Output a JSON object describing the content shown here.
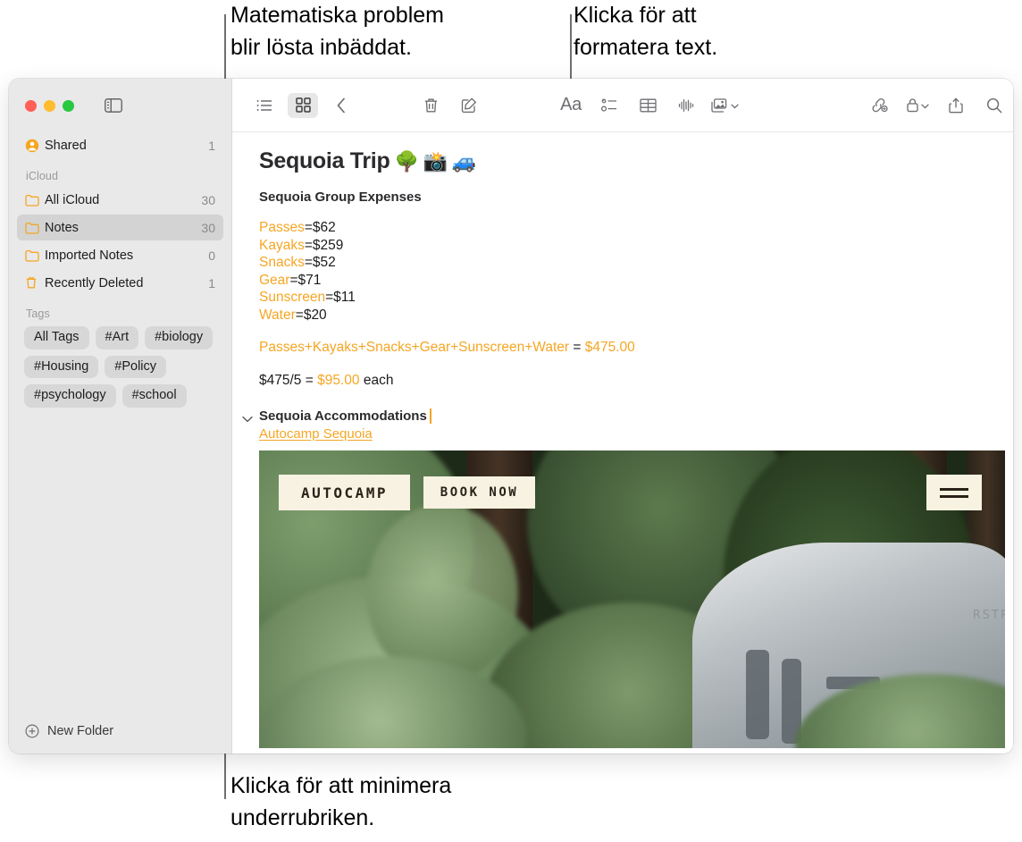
{
  "callouts": {
    "math": "Matematiska problem\nblir lösta inbäddat.",
    "format": "Klicka för att\nformatera text.",
    "minimize": "Klicka för att minimera\nunderrubriken."
  },
  "window": {
    "traffic": {
      "close": "close-button",
      "minimize": "minimize-button",
      "zoom": "zoom-button"
    },
    "sidebar_toggle": "sidebar-toggle-icon"
  },
  "sidebar": {
    "shared": {
      "label": "Shared",
      "count": "1",
      "icon": "shared-person-icon"
    },
    "icloud_section": "iCloud",
    "folders": [
      {
        "label": "All iCloud",
        "count": "30",
        "icon": "folder-icon",
        "selected": false
      },
      {
        "label": "Notes",
        "count": "30",
        "icon": "folder-icon",
        "selected": true
      },
      {
        "label": "Imported Notes",
        "count": "0",
        "icon": "folder-icon",
        "selected": false
      },
      {
        "label": "Recently Deleted",
        "count": "1",
        "icon": "trash-icon",
        "selected": false
      }
    ],
    "tags_section": "Tags",
    "tags": [
      "All Tags",
      "#Art",
      "#biology",
      "#Housing",
      "#Policy",
      "#psychology",
      "#school"
    ],
    "new_folder": "New Folder"
  },
  "toolbar": {
    "list_view": "list-view-icon",
    "gallery_view": "gallery-view-icon",
    "back": "back-chevron-icon",
    "delete": "trash-icon",
    "compose": "compose-icon",
    "format": "Aa",
    "checklist": "checklist-icon",
    "table": "table-icon",
    "audio": "audio-waveform-icon",
    "media": "media-icon",
    "link": "add-link-icon",
    "lock": "lock-icon",
    "share": "share-icon",
    "search": "search-icon"
  },
  "note": {
    "title": "Sequoia Trip",
    "title_emoji": [
      "🌳",
      "📸",
      "🚙"
    ],
    "subtitle": "Sequoia Group Expenses",
    "expenses": [
      {
        "name": "Passes",
        "value": "=$62"
      },
      {
        "name": "Kayaks",
        "value": "=$259"
      },
      {
        "name": "Snacks",
        "value": "=$52"
      },
      {
        "name": "Gear",
        "value": "=$71"
      },
      {
        "name": "Sunscreen",
        "value": "=$11"
      },
      {
        "name": "Water",
        "value": "=$20"
      }
    ],
    "sum_expression": "Passes+Kayaks+Snacks+Gear+Sunscreen+Water",
    "sum_equals": "=",
    "sum_result": "$475.00",
    "division_expression": "$475/5",
    "division_equals": "=",
    "division_result": "$95.00",
    "division_suffix": "each",
    "accommodations_heading": "Sequoia Accommodations",
    "accommodations_link": "Autocamp Sequoia",
    "disclosure_icon": "chevron-down-icon"
  },
  "photo": {
    "logo_badge": "AUTOCAMP",
    "book_badge": "BOOK NOW",
    "menu_badge": "hamburger-menu-icon",
    "trailer_text": "RSTR"
  },
  "colors": {
    "accent_orange": "#f5a623",
    "sidebar_bg": "#e9e9e9",
    "selection": "#d3d3d3"
  }
}
